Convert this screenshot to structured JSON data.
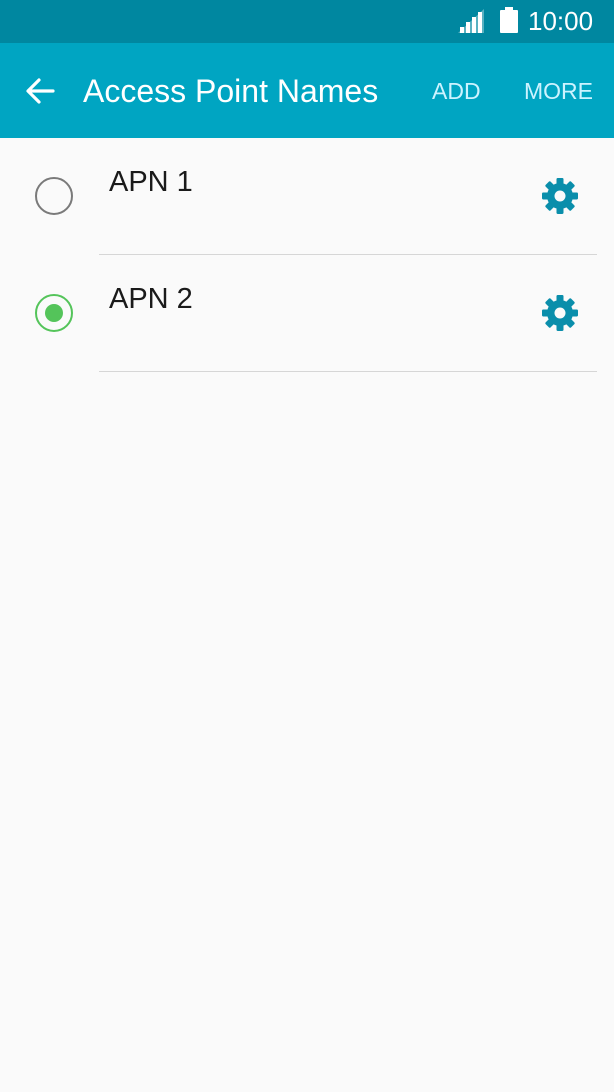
{
  "status_bar": {
    "time": "10:00",
    "signal_icon": "signal-icon",
    "battery_icon": "battery-icon"
  },
  "app_bar": {
    "back_icon": "back-arrow-icon",
    "title": "Access Point Names",
    "add_label": "ADD",
    "more_label": "MORE"
  },
  "apns": [
    {
      "name": "APN 1",
      "selected": false,
      "settings_icon": "gear-icon"
    },
    {
      "name": "APN 2",
      "selected": true,
      "settings_icon": "gear-icon"
    }
  ],
  "colors": {
    "status_bar": "#0087a0",
    "app_bar": "#00a5c2",
    "action_text": "#ccf3ff",
    "radio_selected": "#54c45a",
    "radio_unselected": "#7a7a7a",
    "gear": "#0a8eab",
    "background": "#fafafa"
  }
}
